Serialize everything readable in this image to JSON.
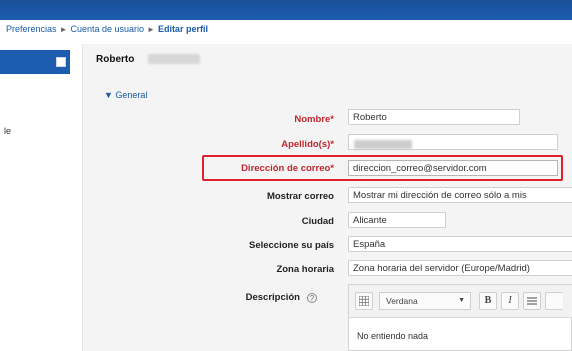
{
  "breadcrumb": {
    "item1": "Preferencias",
    "item2": "Cuenta de usuario",
    "item3": "Editar perfil",
    "separator": "►"
  },
  "profile": {
    "first_name_shown": "Roberto"
  },
  "sidebar": {
    "fragment": "le"
  },
  "form": {
    "legend": "▼ General",
    "fields": {
      "nombre": {
        "label": "Nombre",
        "required_mark": "*",
        "value": "Roberto"
      },
      "apellidos": {
        "label": "Apellido(s)",
        "required_mark": "*"
      },
      "email": {
        "label": "Dirección de correo",
        "required_mark": "*",
        "value": "direccion_correo@servidor.com"
      },
      "mostrar_correo": {
        "label": "Mostrar correo",
        "value": "Mostrar mi dirección de correo sólo a mis"
      },
      "ciudad": {
        "label": "Ciudad",
        "value": "Alicante"
      },
      "pais": {
        "label": "Seleccione su país",
        "value": "España"
      },
      "zona_horaria": {
        "label": "Zona horaria",
        "value": "Zona horaria del servidor (Europe/Madrid)"
      },
      "descripcion": {
        "label": "Descripción"
      }
    },
    "editor": {
      "font": "Verdana",
      "bold": "B",
      "italic": "I",
      "body_text": "No entiendo nada"
    }
  },
  "colors": {
    "topbar": "#1c5db0",
    "required_label": "#c0272d",
    "highlight_box": "#e0202a"
  },
  "icons": {
    "help": "help-icon",
    "editor_menu": "grid-icon",
    "list": "list-icon"
  }
}
